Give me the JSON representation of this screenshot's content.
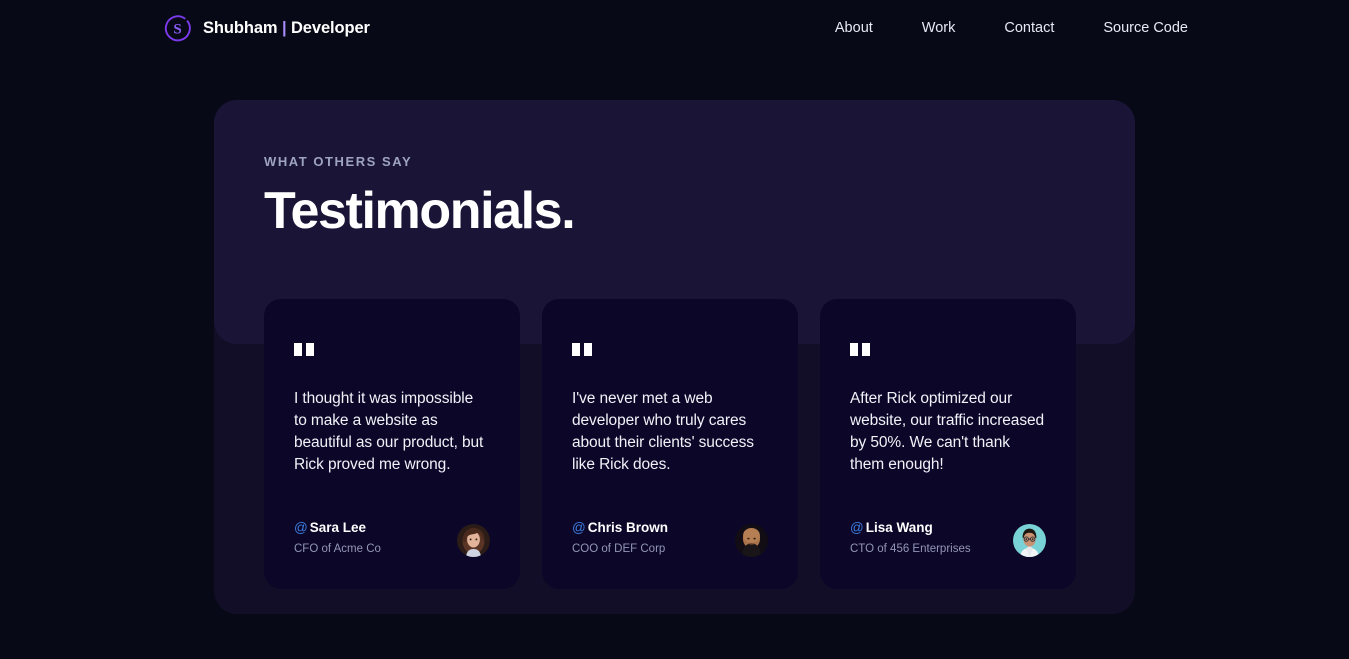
{
  "header": {
    "brand": {
      "logo_icon": "s-monogram-circle-icon",
      "name": "Shubham",
      "separator": "|",
      "role": "Developer"
    },
    "nav": [
      {
        "label": "About"
      },
      {
        "label": "Work"
      },
      {
        "label": "Contact"
      },
      {
        "label": "Source Code"
      }
    ]
  },
  "testimonials": {
    "eyebrow": "WHAT OTHERS SAY",
    "title": "Testimonials.",
    "quote_icon": "double-quote-icon",
    "at_symbol": "@",
    "cards": [
      {
        "quote": "I thought it was impossible to make a website as beautiful as our product, but Rick proved me wrong.",
        "name": "Sara Lee",
        "role": "CFO of Acme Co",
        "avatar_icon": "avatar-sara-lee"
      },
      {
        "quote": "I've never met a web developer who truly cares about their clients' success like Rick does.",
        "name": "Chris Brown",
        "role": "COO of DEF Corp",
        "avatar_icon": "avatar-chris-brown"
      },
      {
        "quote": "After Rick optimized our website, our traffic increased by 50%. We can't thank them enough!",
        "name": "Lisa Wang",
        "role": "CTO of 456 Enterprises",
        "avatar_icon": "avatar-lisa-wang"
      }
    ]
  },
  "colors": {
    "page_background": "#070a16",
    "panel_upper": "#1a1537",
    "panel_lower": "#130e28",
    "card_background": "#0c0628",
    "accent_purple": "#a78bfa",
    "accent_blue": "#3d7fe0",
    "text_primary": "#ffffff",
    "text_muted": "#9296b8"
  }
}
